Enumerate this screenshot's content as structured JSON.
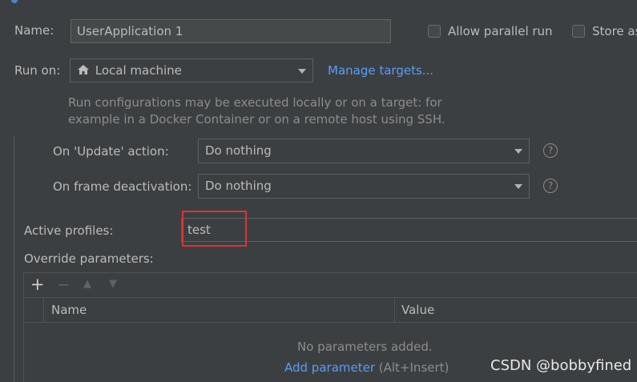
{
  "name_row": {
    "label": "Name:",
    "value": "UserApplication 1",
    "allow_parallel_run": "Allow parallel run",
    "store_as": "Store as"
  },
  "run_on": {
    "label": "Run on:",
    "selected": "Local machine",
    "manage_targets": "Manage targets...",
    "hint_line1": "Run configurations may be executed locally or on a target: for",
    "hint_line2": "example in a Docker Container or on a remote host using SSH."
  },
  "update_action": {
    "label": "On 'Update' action:",
    "selected": "Do nothing"
  },
  "frame_deactivation": {
    "label": "On frame deactivation:",
    "selected": "Do nothing"
  },
  "active_profiles": {
    "label": "Active profiles:",
    "value": "test"
  },
  "override": {
    "label": "Override parameters:",
    "toolbar": {
      "add": "+",
      "remove": "−",
      "up": "▲",
      "down": "▼"
    },
    "columns": [
      "Name",
      "Value"
    ],
    "empty_text": "No parameters added.",
    "add_parameter": "Add parameter",
    "shortcut": "(Alt+Insert)"
  },
  "watermark": "CSDN @bobbyfined",
  "colors": {
    "background": "#3c3f41",
    "link": "#589df6",
    "highlight": "#e03232"
  }
}
